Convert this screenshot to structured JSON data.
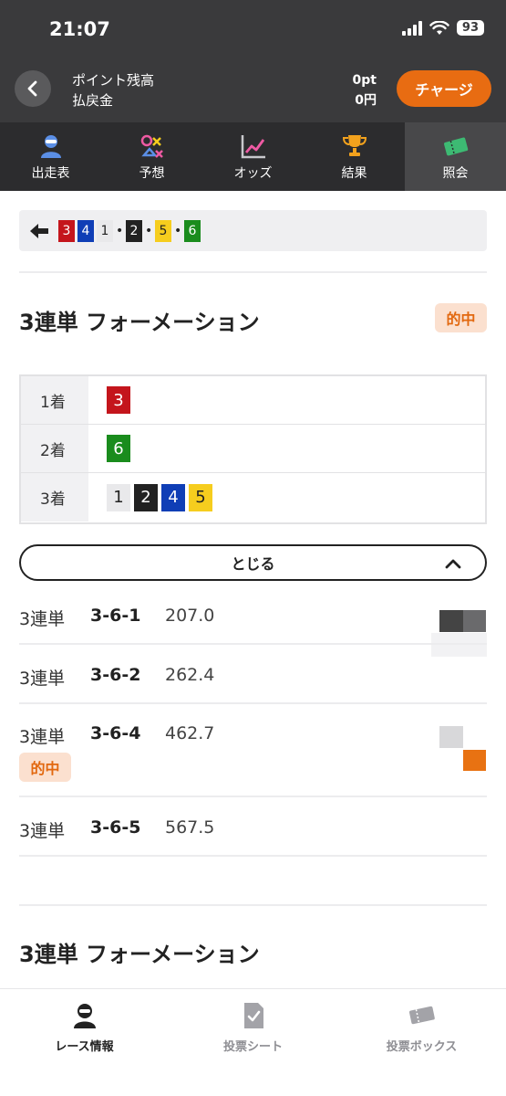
{
  "status_bar": {
    "time": "21:07",
    "battery": "93"
  },
  "header": {
    "points_label": "ポイント残高",
    "payout_label": "払戻金",
    "points_value": "0pt",
    "payout_value": "0円",
    "charge_label": "チャージ"
  },
  "tabs": [
    {
      "label": "出走表",
      "icon": "racer-icon"
    },
    {
      "label": "予想",
      "icon": "prediction-icon"
    },
    {
      "label": "オッズ",
      "icon": "odds-chart-icon"
    },
    {
      "label": "結果",
      "icon": "trophy-icon"
    },
    {
      "label": "照会",
      "icon": "ticket-icon",
      "active": true
    }
  ],
  "history": {
    "numbers": [
      "3",
      "4",
      "1",
      "2",
      "5",
      "6"
    ],
    "separator": "•"
  },
  "sections": [
    {
      "title": "3連単 フォーメーション",
      "badge": "的中"
    },
    {
      "title": "3連単 フォーメーション"
    }
  ],
  "formation": {
    "rows": [
      {
        "label": "1着",
        "numbers": [
          "3"
        ]
      },
      {
        "label": "2着",
        "numbers": [
          "6"
        ]
      },
      {
        "label": "3着",
        "numbers": [
          "1",
          "2",
          "4",
          "5"
        ]
      }
    ]
  },
  "close_button": {
    "label": "とじる"
  },
  "results": [
    {
      "bet_type": "3連単",
      "combination": "3-6-1",
      "odds": "207.0"
    },
    {
      "bet_type": "3連単",
      "combination": "3-6-2",
      "odds": "262.4"
    },
    {
      "bet_type": "3連単",
      "combination": "3-6-4",
      "odds": "462.7",
      "badge": "的中"
    },
    {
      "bet_type": "3連単",
      "combination": "3-6-5",
      "odds": "567.5"
    }
  ],
  "bottom_nav": [
    {
      "label": "レース情報",
      "icon": "racer-icon",
      "active": true
    },
    {
      "label": "投票シート",
      "icon": "check-sheet-icon"
    },
    {
      "label": "投票ボックス",
      "icon": "ticket-box-icon"
    }
  ],
  "colors": {
    "header_bg": "#3a3a3c",
    "tab_bg": "#2c2c2e",
    "accent_orange": "#e86c12",
    "hit_badge_bg": "#fbe0cf",
    "hit_badge_text": "#e2680f",
    "boat_1": "#e9e9eb",
    "boat_2": "#222222",
    "boat_3": "#c4151c",
    "boat_4": "#0f3eb6",
    "boat_5": "#f6cd1e",
    "boat_6": "#1a8c1d"
  }
}
